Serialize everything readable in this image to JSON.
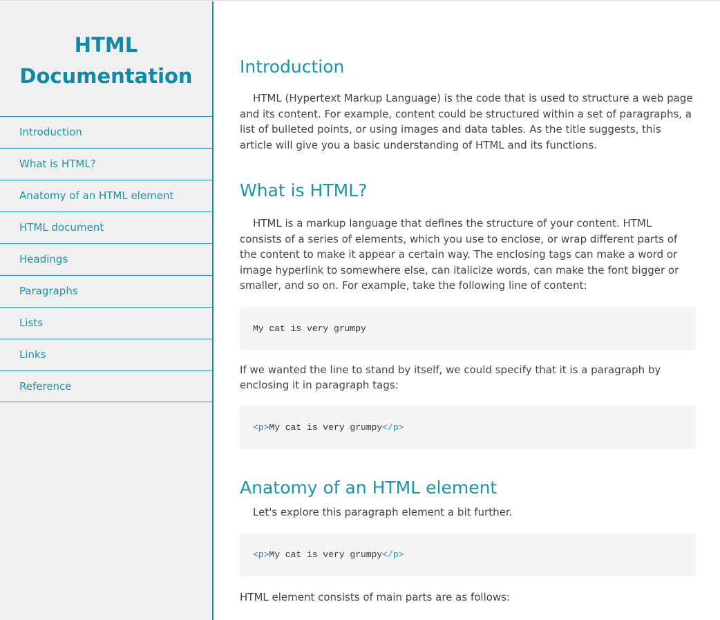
{
  "nav": {
    "title_line1": "HTML",
    "title_line2": "Documentation",
    "items": [
      {
        "label": "Introduction"
      },
      {
        "label": "What is HTML?"
      },
      {
        "label": "Anatomy of an HTML element"
      },
      {
        "label": "HTML document"
      },
      {
        "label": "Headings"
      },
      {
        "label": "Paragraphs"
      },
      {
        "label": "Lists"
      },
      {
        "label": "Links"
      },
      {
        "label": "Reference"
      }
    ]
  },
  "main": {
    "intro": {
      "title": "Introduction",
      "p1": "HTML (Hypertext Markup Language) is the code that is used to structure a web page and its content. For example, content could be structured within a set of paragraphs, a list of bulleted points, or using images and data tables. As the title suggests, this article will give you a basic understanding of HTML and its functions."
    },
    "what": {
      "title": "What is HTML?",
      "p1": "HTML is a markup language that defines the structure of your content. HTML consists of a series of elements, which you use to enclose, or wrap different parts of the content to make it appear a certain way. The enclosing tags can make a word or image hyperlink to somewhere else, can italicize words, can make the font bigger or smaller, and so on. For example, take the following line of content:",
      "code1": "My cat is very grumpy",
      "p2": "If we wanted the line to stand by itself, we could specify that it is a paragraph by enclosing it in paragraph tags:",
      "code2_open": "<p>",
      "code2_text": "My cat is very grumpy",
      "code2_close": "</p>"
    },
    "anatomy": {
      "title": "Anatomy of an HTML element",
      "p1": "Let's explore this paragraph element a bit further.",
      "code_open": "<p>",
      "code_text": "My cat is very grumpy",
      "code_close": "</p>",
      "p2": "HTML element consists of main parts are as follows:"
    }
  }
}
